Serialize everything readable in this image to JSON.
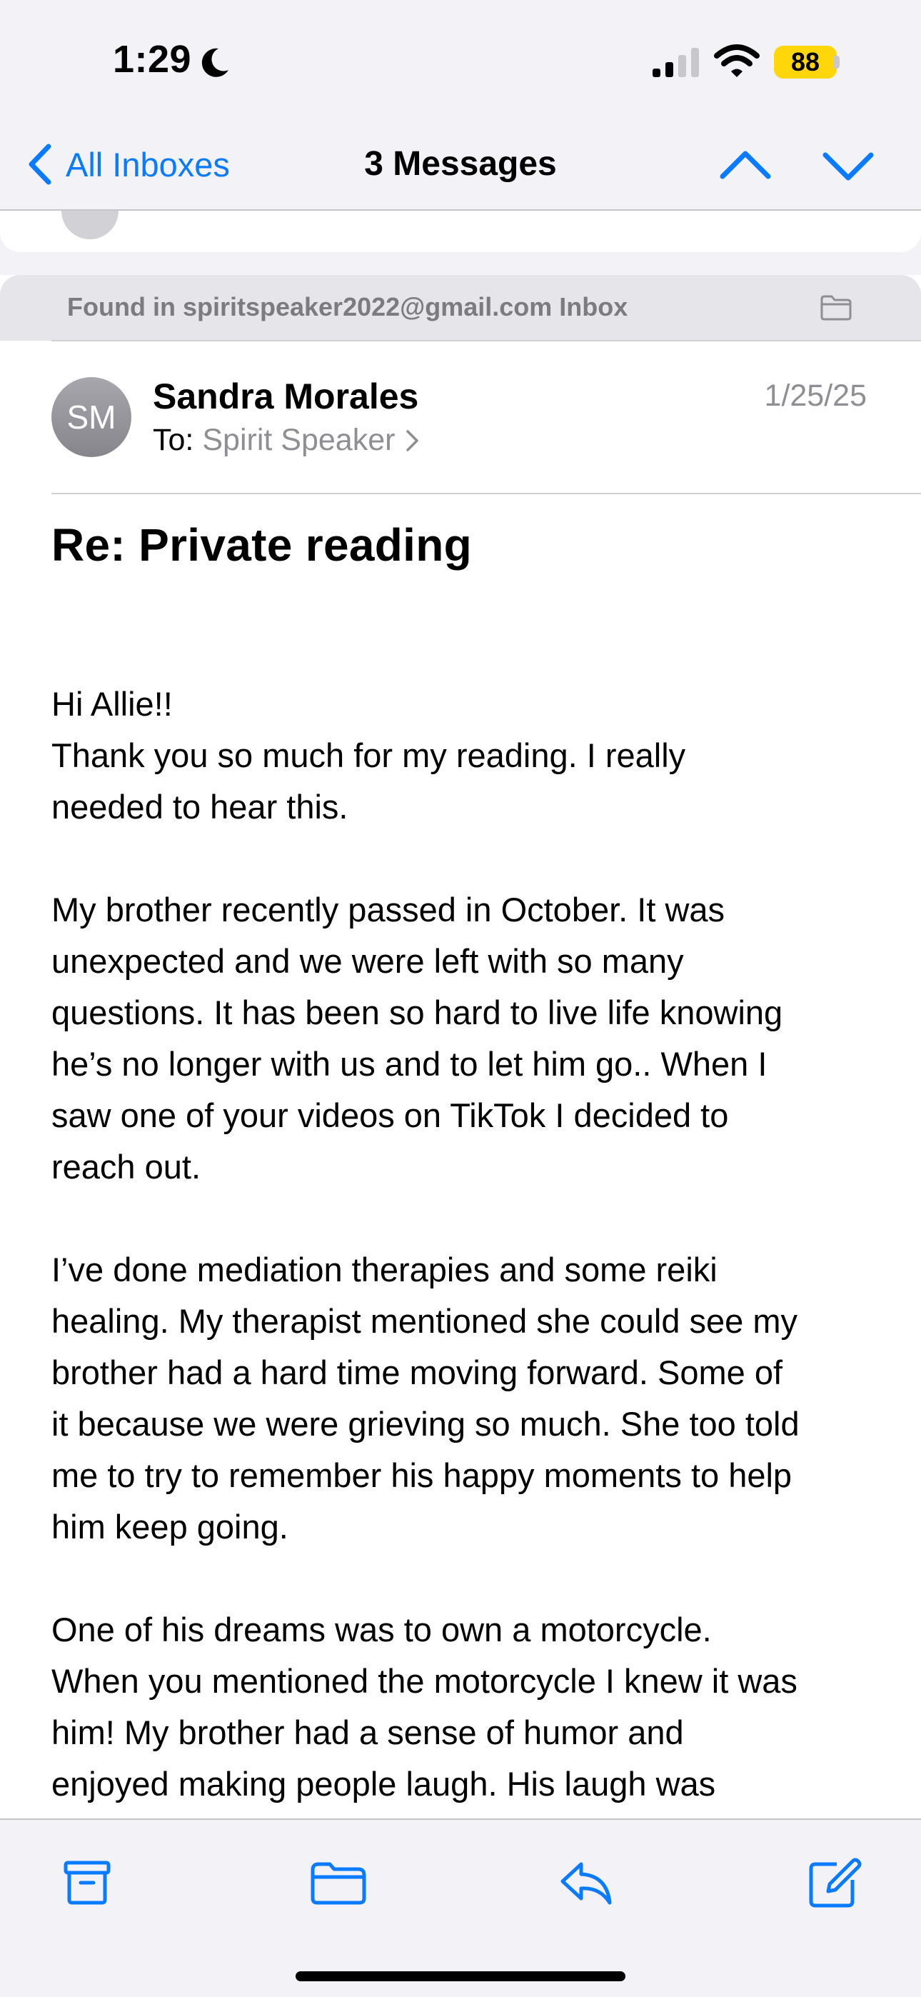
{
  "status_bar": {
    "time": "1:29",
    "battery_level": "88",
    "icons": [
      "moon-icon",
      "signal-icon",
      "wifi-icon",
      "battery-icon"
    ]
  },
  "nav": {
    "back_label": "All Inboxes",
    "title": "3 Messages",
    "icons": [
      "chevron-left-icon",
      "chevron-up-icon",
      "chevron-down-icon"
    ]
  },
  "found_in": {
    "text": "Found in spiritspeaker2022@gmail.com Inbox",
    "icon": "folder-icon"
  },
  "message": {
    "avatar_initials": "SM",
    "sender": "Sandra Morales",
    "to_label": "To:",
    "recipient": "Spirit Speaker",
    "date": "1/25/25",
    "subject": "Re: Private reading",
    "body": {
      "p1": [
        "Hi Allie!!",
        "Thank you so much for my reading. I really",
        "needed to hear this."
      ],
      "p2": [
        "My brother recently passed in October. It was",
        "unexpected and we were left with so many",
        "questions. It has been so hard to live life knowing",
        "he’s no longer with us and to let him go.. When I",
        "saw one of your videos on TikTok I decided to",
        "reach out."
      ],
      "p3": [
        "I’ve done mediation therapies and some reiki",
        "healing. My therapist mentioned she could see my",
        "brother had a hard time moving forward. Some of",
        "it because we were grieving so much. She too told",
        "me to try to remember his happy moments to help",
        "him keep going."
      ],
      "p4": [
        "One of his dreams was to own a motorcycle.",
        "When you mentioned the motorcycle I knew it was",
        "him! My brother had a sense of humor and",
        "enjoyed making people laugh. His laugh was"
      ]
    }
  },
  "toolbar": {
    "icons": [
      "archive-icon",
      "move-to-folder-icon",
      "reply-icon",
      "compose-icon"
    ]
  },
  "colors": {
    "accent": "#0a7aff",
    "battery": "#ffd60a",
    "secondary_text": "#8e8e93",
    "bar_background": "#f2f2f7"
  }
}
